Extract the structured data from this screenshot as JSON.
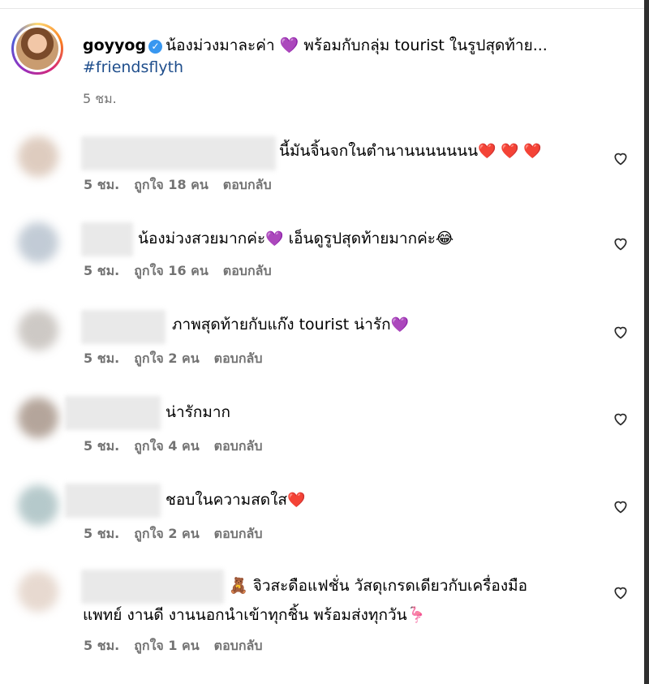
{
  "post": {
    "username": "goyyog",
    "caption": "น้องม่วงมาละค่า 💜 พร้อมกับกลุ่ม tourist ในรูปสุดท้าย...",
    "hashtag": "#friendsflyth",
    "time": "5 ชม."
  },
  "comments": [
    {
      "text_before": "นี้มันจิ้นจกในตำนานนนนนนน",
      "emoji": "❤️ ❤️ ❤️",
      "text_after": "",
      "time": "5 ชม.",
      "likes": "ถูกใจ 18 คน",
      "reply": "ตอบกลับ"
    },
    {
      "text_before": "น้องม่วงสวยมากค่ะ",
      "emoji": "💜",
      "text_after": " เอ็นดูรูปสุดท้ายมากค่ะ😂",
      "time": "5 ชม.",
      "likes": "ถูกใจ 16 คน",
      "reply": "ตอบกลับ"
    },
    {
      "text_before": "ภาพสุดท้ายกับแก๊ง tourist น่ารัก",
      "emoji": "💜",
      "text_after": "",
      "time": "5 ชม.",
      "likes": "ถูกใจ 2 คน",
      "reply": "ตอบกลับ"
    },
    {
      "text_before": "น่ารักมาก",
      "emoji": "",
      "text_after": "",
      "time": "5 ชม.",
      "likes": "ถูกใจ 4 คน",
      "reply": "ตอบกลับ"
    },
    {
      "text_before": "ชอบในความสดใส",
      "emoji": "❤️",
      "text_after": "",
      "time": "5 ชม.",
      "likes": "ถูกใจ 2 คน",
      "reply": "ตอบกลับ"
    },
    {
      "text_before": "🧸 จิวสะดือแฟชั่น วัสดุเกรดเดียวกับเครื่องมือ",
      "line2": "แพทย์ งานดี งานนอกนำเข้าทุกชิ้น พร้อมส่งทุกวัน🦩",
      "emoji": "",
      "text_after": "",
      "time": "5 ชม.",
      "likes": "ถูกใจ 1 คน",
      "reply": "ตอบกลับ"
    }
  ],
  "colors": {
    "link": "#1f4e8c",
    "muted": "#737373",
    "verified": "#3897f0"
  },
  "icons": {
    "like": "heart-outline-icon",
    "verified": "verified-badge-icon"
  }
}
